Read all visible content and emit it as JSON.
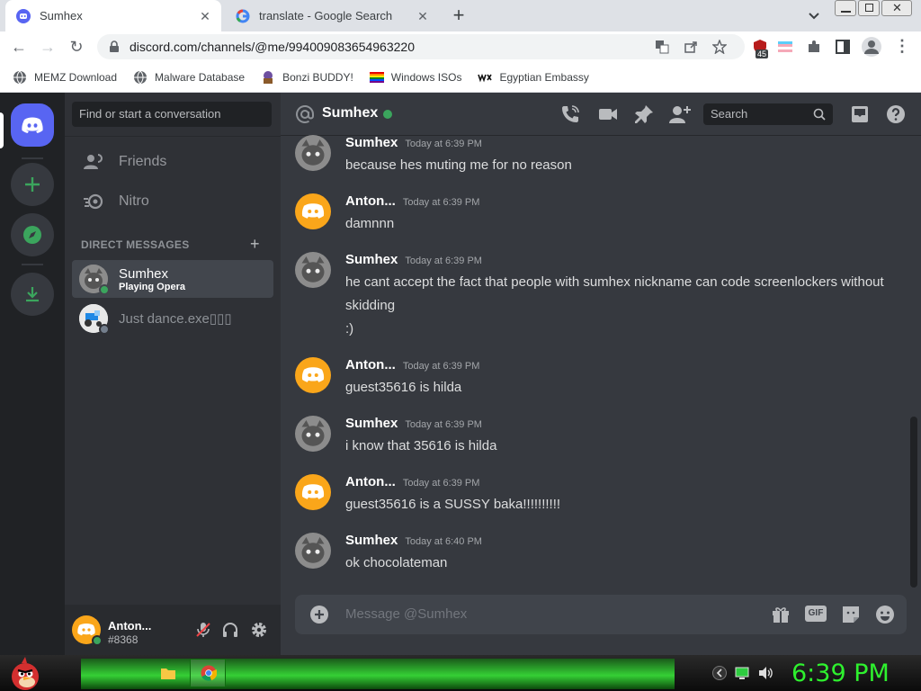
{
  "browser": {
    "tabs": [
      {
        "title": "Sumhex",
        "active": true
      },
      {
        "title": "translate - Google Search",
        "active": false
      }
    ],
    "url": "discord.com/channels/@me/994009083654963220",
    "extension_badge": "45",
    "bookmarks": [
      {
        "label": "MEMZ Download",
        "icon": "globe-icon"
      },
      {
        "label": "Malware Database",
        "icon": "globe-icon"
      },
      {
        "label": "Bonzi BUDDY!",
        "icon": "bonzi-icon"
      },
      {
        "label": "Windows ISOs",
        "icon": "rainbow-flag-icon"
      },
      {
        "label": "Egyptian Embassy",
        "icon": "wix-icon"
      }
    ]
  },
  "discord": {
    "sidebar": {
      "search_placeholder": "Find or start a conversation",
      "nav": [
        {
          "label": "Friends"
        },
        {
          "label": "Nitro"
        }
      ],
      "dm_header": "DIRECT MESSAGES",
      "dms": [
        {
          "name": "Sumhex",
          "status": "Playing Opera",
          "selected": true
        },
        {
          "name": "Just dance.exe▯▯▯",
          "status": "",
          "selected": false
        }
      ]
    },
    "user_panel": {
      "name": "Anton...",
      "tag": "#8368"
    },
    "chat": {
      "channel_name": "Sumhex",
      "search_placeholder": "Search",
      "composer_placeholder": "Message @Sumhex",
      "messages": [
        {
          "author": "Sumhex",
          "time": "Today at 6:39 PM",
          "lines": [
            "because hes muting me for no reason"
          ]
        },
        {
          "author": "Anton...",
          "time": "Today at 6:39 PM",
          "lines": [
            "damnnn"
          ]
        },
        {
          "author": "Sumhex",
          "time": "Today at 6:39 PM",
          "lines": [
            "he cant accept the fact that people with sumhex nickname can code screenlockers without skidding",
            ":)"
          ]
        },
        {
          "author": "Anton...",
          "time": "Today at 6:39 PM",
          "lines": [
            "guest35616 is hilda"
          ]
        },
        {
          "author": "Sumhex",
          "time": "Today at 6:39 PM",
          "lines": [
            "i know that 35616 is hilda"
          ]
        },
        {
          "author": "Anton...",
          "time": "Today at 6:39 PM",
          "lines": [
            "guest35616 is a SUSSY baka!!!!!!!!!!"
          ]
        },
        {
          "author": "Sumhex",
          "time": "Today at 6:40 PM",
          "lines": [
            "ok chocolateman"
          ]
        }
      ]
    },
    "colors": {
      "blurple": "#5865f2",
      "green": "#3ba55d",
      "discord_orange": "#faa61a"
    }
  },
  "taskbar": {
    "clock": "6:39 PM"
  }
}
